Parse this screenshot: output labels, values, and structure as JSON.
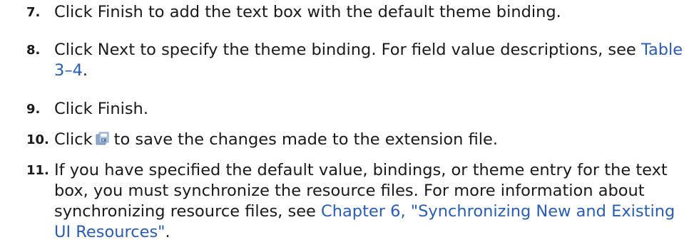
{
  "steps": [
    {
      "number": "7.",
      "text": "Click Finish to add the text box with the default theme binding."
    },
    {
      "number": "8.",
      "text_before": "Click Next to specify the theme binding. For field value descriptions, see ",
      "link": "Table 3–4",
      "text_after": "."
    },
    {
      "number": "9.",
      "text": "Click Finish."
    },
    {
      "number": "10.",
      "text_before": "Click",
      "icon": "save-all-icon",
      "text_after": "to save the changes made to the extension file."
    },
    {
      "number": "11.",
      "text_before": "If you have specified the default value, bindings, or theme entry for the text box, you must synchronize the resource files. For more information about synchronizing resource files, see ",
      "link": "Chapter 6, \"Synchronizing New and Existing UI Resources\"",
      "text_after": "."
    }
  ],
  "colors": {
    "text": "#1a1a1a",
    "link": "#2a5db0"
  }
}
